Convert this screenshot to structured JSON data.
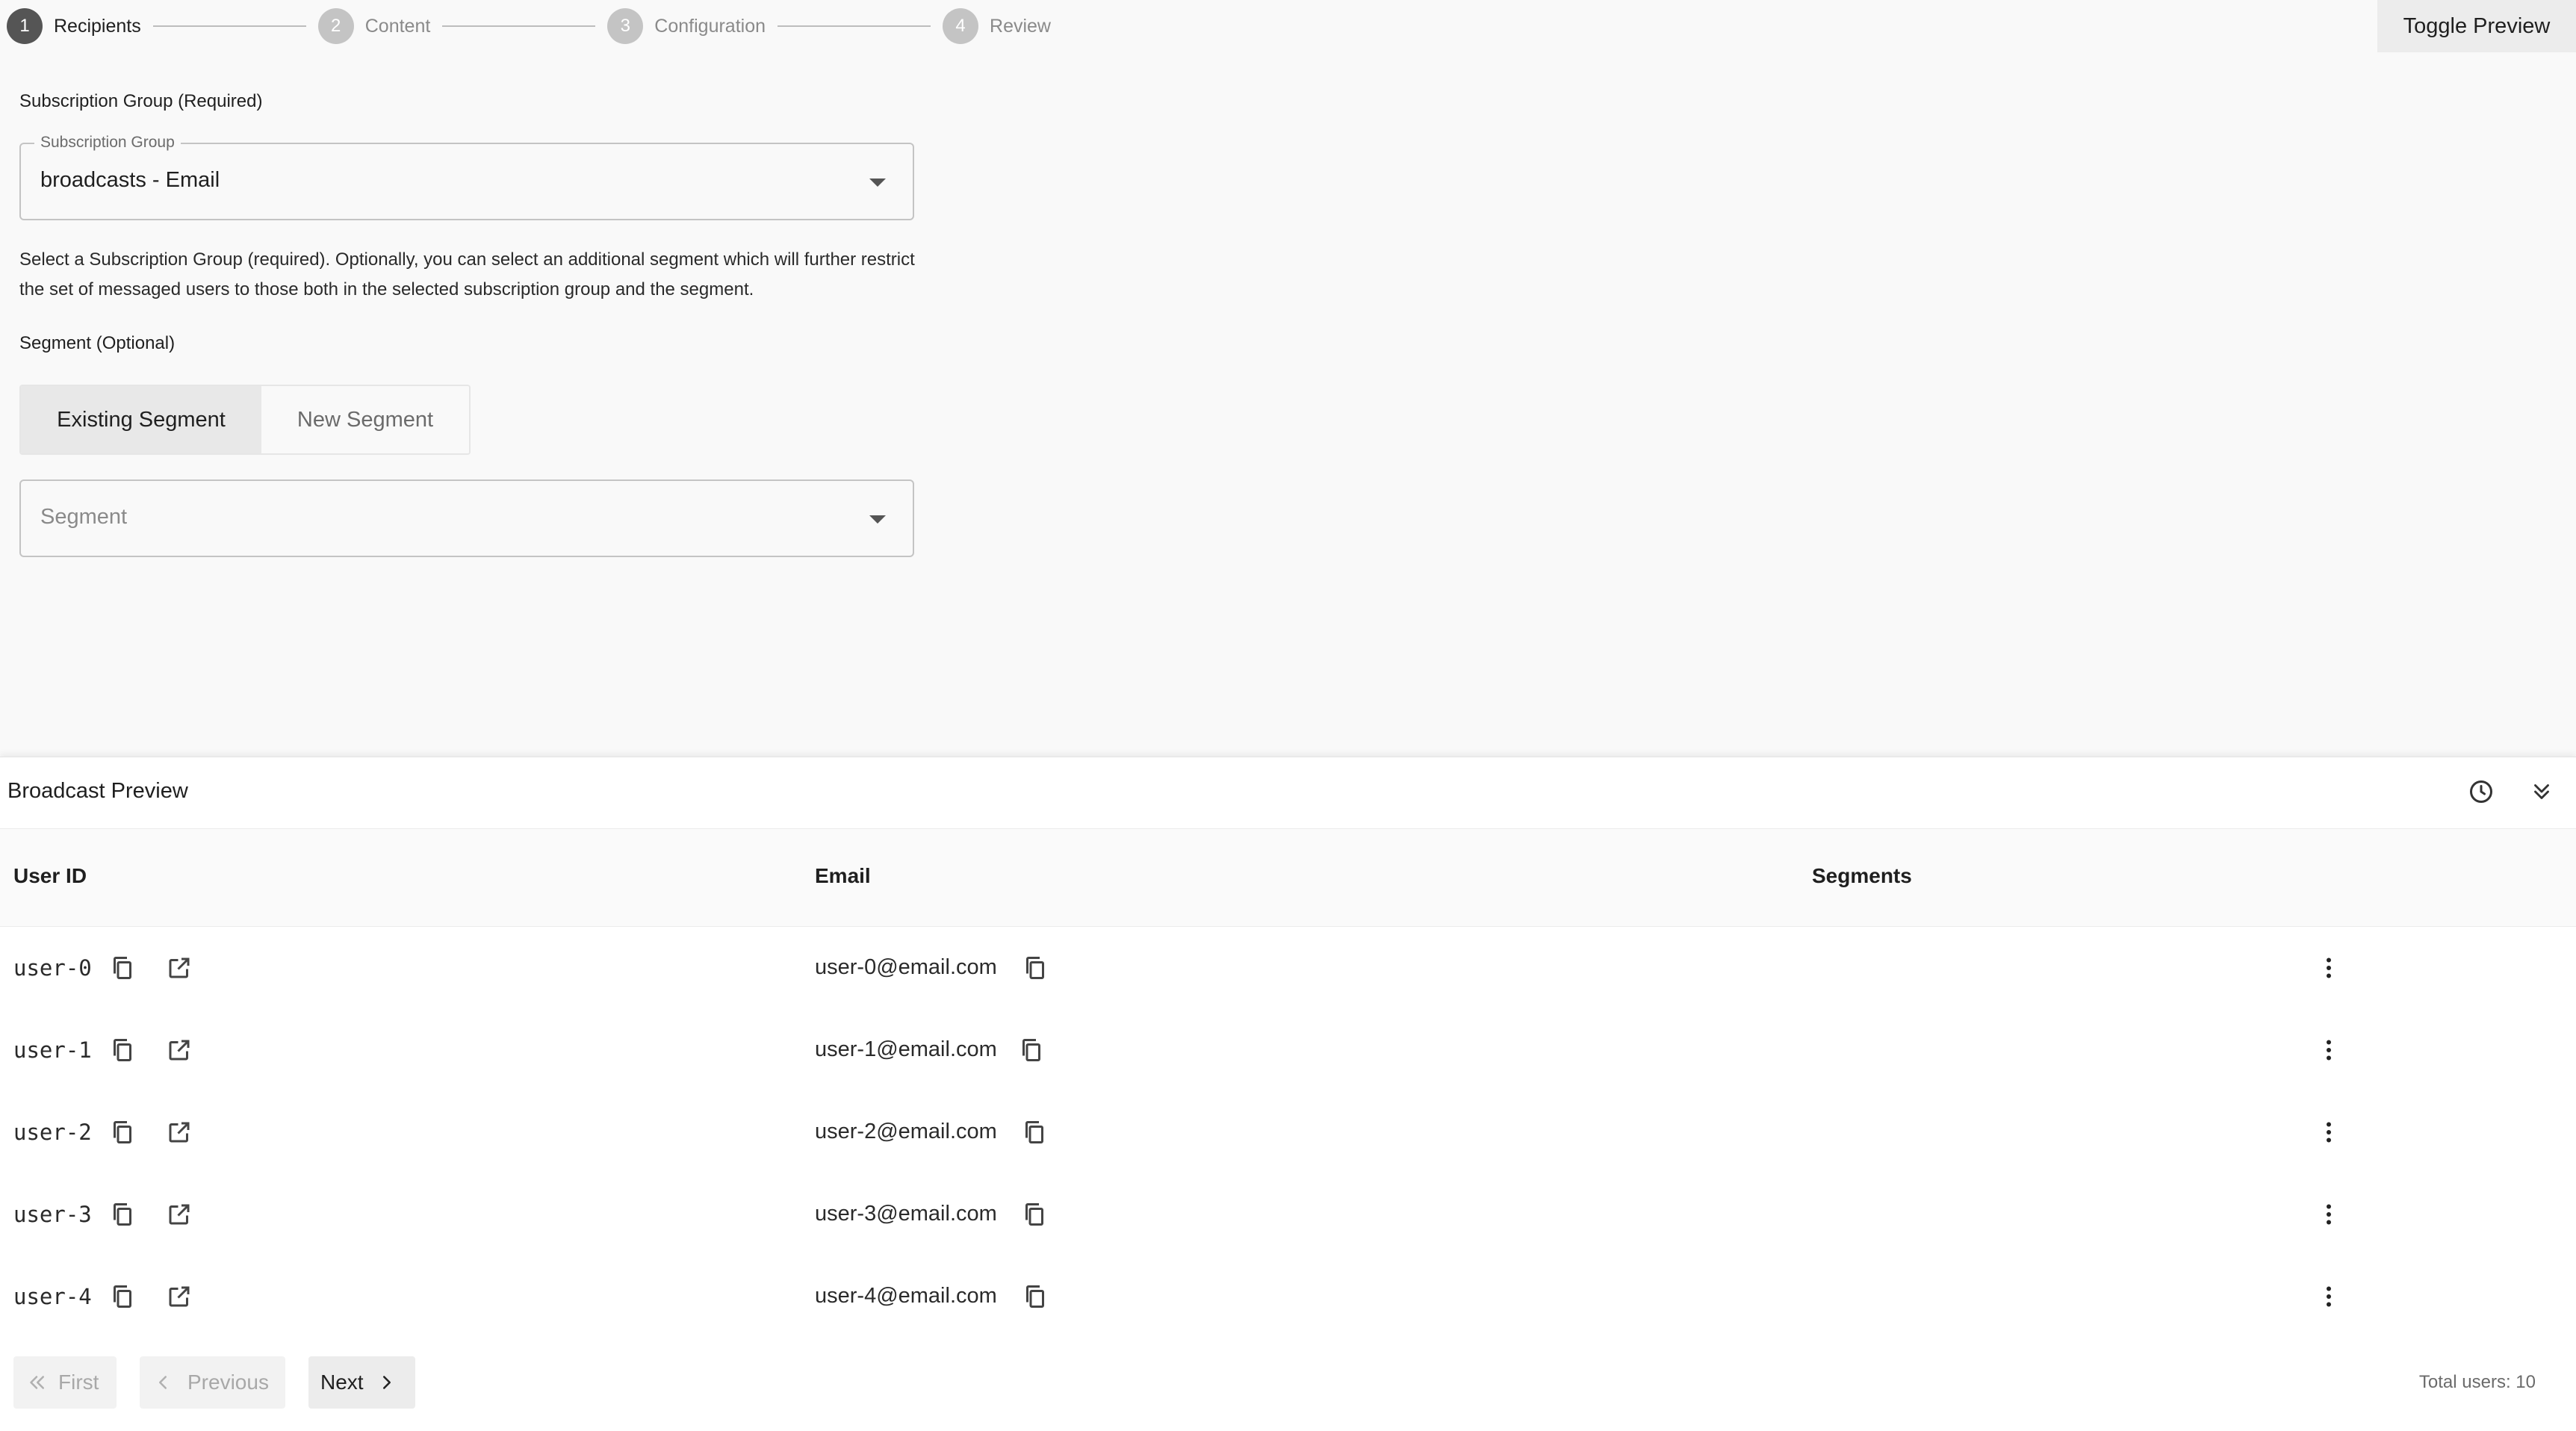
{
  "stepper": {
    "steps": [
      {
        "number": "1",
        "label": "Recipients",
        "active": true
      },
      {
        "number": "2",
        "label": "Content",
        "active": false
      },
      {
        "number": "3",
        "label": "Configuration",
        "active": false
      },
      {
        "number": "4",
        "label": "Review",
        "active": false
      }
    ]
  },
  "header": {
    "toggle_preview_label": "Toggle Preview"
  },
  "recipients": {
    "subscription_group_label": "Subscription Group (Required)",
    "subscription_group_legend": "Subscription Group",
    "subscription_group_value": "broadcasts - Email",
    "help_text": "Select a Subscription Group (required). Optionally, you can select an additional segment which will further restrict the set of messaged users to those both in the selected subscription group and the segment.",
    "segment_label": "Segment (Optional)",
    "segment_tabs": [
      {
        "label": "Existing Segment",
        "selected": true
      },
      {
        "label": "New Segment",
        "selected": false
      }
    ],
    "segment_placeholder": "Segment"
  },
  "preview": {
    "title": "Broadcast Preview",
    "icons": {
      "history": "clock-icon",
      "collapse": "double-chevron-down-icon"
    },
    "columns": [
      "User ID",
      "Email",
      "Segments"
    ],
    "rows": [
      {
        "user_id": "user-0",
        "email": "user-0@email.com",
        "segments": ""
      },
      {
        "user_id": "user-1",
        "email": "user-1@email.com",
        "segments": ""
      },
      {
        "user_id": "user-2",
        "email": "user-2@email.com",
        "segments": ""
      },
      {
        "user_id": "user-3",
        "email": "user-3@email.com",
        "segments": ""
      },
      {
        "user_id": "user-4",
        "email": "user-4@email.com",
        "segments": ""
      }
    ],
    "pagination": {
      "first_label": "First",
      "previous_label": "Previous",
      "next_label": "Next",
      "total_users": "Total users: 10"
    }
  },
  "colors": {
    "background": "#f9f9f9",
    "active_step": "#555555",
    "inactive_step": "#c4c4c4",
    "panel": "#ffffff"
  }
}
